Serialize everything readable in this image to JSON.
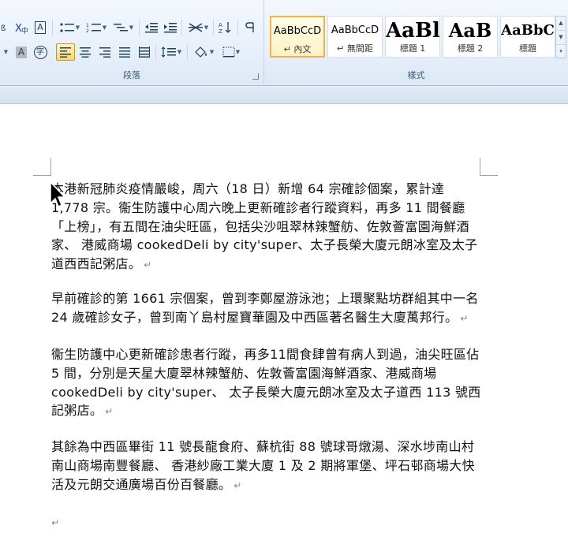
{
  "ribbon": {
    "paragraph_group": {
      "label": "段落",
      "asian_layout_glyph": "A",
      "enclose_glyph": "字"
    },
    "styles_group": {
      "label": "樣式",
      "styles": [
        {
          "preview": "AaBbCcD",
          "name": "↵ 內文",
          "selected": true
        },
        {
          "preview": "AaBbCcD",
          "name": "↵ 無間距",
          "selected": false
        },
        {
          "preview": "AaBl",
          "name": "標題 1",
          "selected": false
        },
        {
          "preview": "AaB",
          "name": "標題 2",
          "selected": false
        },
        {
          "preview": "AaBbC",
          "name": "標題",
          "selected": false
        }
      ]
    }
  },
  "document": {
    "paragraphs": [
      "本港新冠肺炎疫情嚴峻，周六（18 日）新增 64 宗確診個案，累計達 1,778 宗。衞生防護中心周六晚上更新確診者行蹤資料，再多 11 間餐廳「上榜」，有五間在油尖旺區，包括尖沙咀翠林辣蟹舫、佐敦薈富園海鮮酒家、  港威商場  cookedDeli by city'super、太子長榮大廈元朗冰室及太子道西西記粥店。",
      "早前確診的第 1661 宗個案，曾到李鄭屋游泳池；上環聚點坊群組其中一名 24 歲確診女子，曾到南丫島村屋寶華園及中西區著名醫生大廈萬邦行。",
      "衞生防護中心更新確診患者行蹤，再多11間食肆曾有病人到過，油尖旺區佔 5 間，分別是天星大廈翠林辣蟹舫、佐敦薈富園海鮮酒家、港威商場  cookedDeli by city'super、  太子長榮大廈元朗冰室及太子道西 113 號西記粥店。",
      "其餘為中西區畢街 11 號長龍食府、蘇杭街 88 號球哥燉湯、深水埗南山村南山商場南豐餐廳、  香港紗廠工業大廈 1 及 2  期將軍堡、坪石邨商場大快活及元朗交通廣場百份百餐廳。"
    ],
    "paragraph_mark": "↵"
  },
  "colors": {
    "ribbon_bg": "#e8f0fa",
    "active_button": "#fcd66b",
    "spell_error": "#d33",
    "grammar": "#4caf50"
  }
}
